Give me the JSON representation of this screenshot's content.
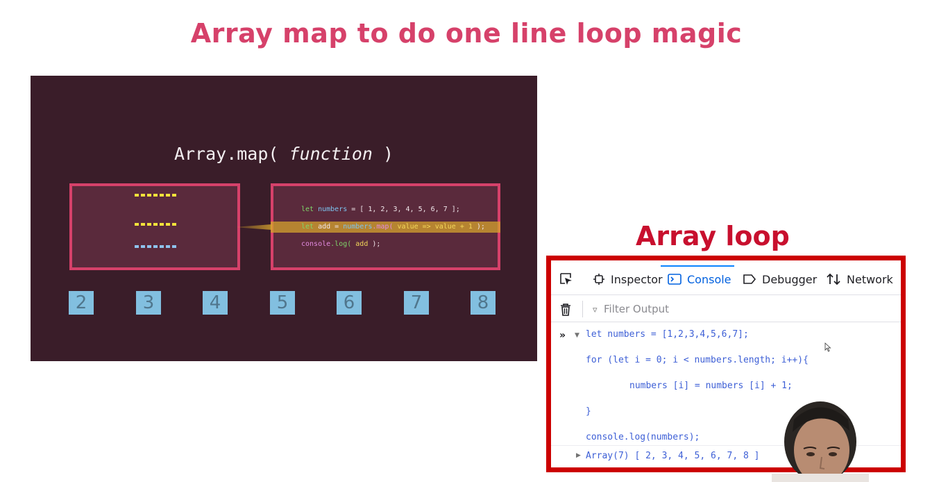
{
  "slide": {
    "title": "Array map to do one line loop magic"
  },
  "animation": {
    "heading_prefix": "Array.map(",
    "heading_fn": "function",
    "heading_suffix": ")",
    "code": {
      "line1_kw": "let",
      "line1_var": "numbers",
      "line1_rest": " = [ 1, 2, 3, 4, 5, 6, 7 ];",
      "line2_kw": "let",
      "line2_var": "add",
      "line2_eq": " = ",
      "line2_obj": "numbers",
      "line2_map": ".map(",
      "line2_arg": " value => value + 1",
      "line2_end": " );",
      "line3_obj": "console",
      "line3_fn": ".log(",
      "line3_arg": " add",
      "line3_end": " );"
    },
    "tiles": [
      "2",
      "3",
      "4",
      "5",
      "6",
      "7",
      "8"
    ],
    "colors": {
      "accent": "#d6416a",
      "dot_yellow": "#f3e23a",
      "dot_blue": "#8ec3ee"
    }
  },
  "devtools": {
    "section_title": "Array loop",
    "tabs": [
      {
        "label": "Inspector",
        "icon": "inspector-icon"
      },
      {
        "label": "Console",
        "icon": "console-icon"
      },
      {
        "label": "Debugger",
        "icon": "debugger-icon"
      },
      {
        "label": "Network",
        "icon": "network-icon"
      }
    ],
    "filter_placeholder": "Filter Output",
    "console_lines": [
      "let numbers = [1,2,3,4,5,6,7];",
      "for (let i = 0; i < numbers.length; i++){",
      "numbers [i] = numbers [i] + 1;",
      "}",
      "console.log(numbers);"
    ],
    "result": "Array(7) [ 2, 3, 4, 5, 6, 7, 8 ]",
    "colors": {
      "frame": "#cc0000",
      "active_tab": "#0060df",
      "code": "#3d5fd6"
    }
  }
}
